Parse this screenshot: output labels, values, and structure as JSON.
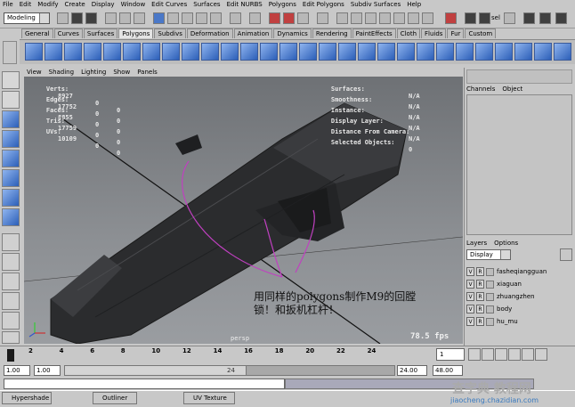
{
  "menubar": {
    "items": [
      "File",
      "Edit",
      "Modify",
      "Create",
      "Display",
      "Window",
      "Edit Curves",
      "Surfaces",
      "Edit NURBS",
      "Polygons",
      "Edit Polygons",
      "Subdiv Surfaces",
      "Help"
    ]
  },
  "statusline": {
    "mode": "Modeling",
    "sel_label": "sel"
  },
  "shelf": {
    "tabs": [
      "General",
      "Curves",
      "Surfaces",
      "Polygons",
      "Subdivs",
      "Deformation",
      "Animation",
      "Dynamics",
      "Rendering",
      "PaintEffects",
      "Cloth",
      "Fluids",
      "Fur",
      "Custom"
    ],
    "active_tab": "Polygons"
  },
  "panel_menu": [
    "View",
    "Shading",
    "Lighting",
    "Show",
    "Panels"
  ],
  "hud": {
    "rows": [
      {
        "label": "Verts:",
        "values": [
          "8927",
          "0",
          "0"
        ]
      },
      {
        "label": "Edges:",
        "values": [
          "17752",
          "0",
          "0"
        ]
      },
      {
        "label": "Faces:",
        "values": [
          "8855",
          "0",
          "0"
        ]
      },
      {
        "label": "Tris:",
        "values": [
          "17759",
          "0",
          "0"
        ]
      },
      {
        "label": "UVs:",
        "values": [
          "10109",
          "0",
          "0"
        ]
      }
    ],
    "right_rows": [
      {
        "label": "Surfaces:",
        "value": "N/A"
      },
      {
        "label": "Smoothness:",
        "value": "N/A"
      },
      {
        "label": "Instance:",
        "value": "N/A"
      },
      {
        "label": "Display Layer:",
        "value": "N/A"
      },
      {
        "label": "Distance From Camera:",
        "value": "N/A"
      },
      {
        "label": "Selected Objects:",
        "value": "0"
      }
    ],
    "fps": "78.5 fps",
    "camera": "persp"
  },
  "annotation": {
    "line1": "用同样的polygons制作M9的回膛",
    "line2": "锁！和扳机杠杆！"
  },
  "channel_box": {
    "menu": [
      "Channels",
      "Object"
    ]
  },
  "layers": {
    "menu": [
      "Layers",
      "Options"
    ],
    "display": "Display",
    "items": [
      {
        "v": "V",
        "r": "R",
        "name": "fasheqiangguan"
      },
      {
        "v": "V",
        "r": "R",
        "name": "xiaguan"
      },
      {
        "v": "V",
        "r": "R",
        "name": "zhuangzhen"
      },
      {
        "v": "V",
        "r": "R",
        "name": "body"
      },
      {
        "v": "V",
        "r": "R",
        "name": "hu_mu"
      }
    ]
  },
  "timeline": {
    "ticks": [
      "2",
      "4",
      "6",
      "8",
      "10",
      "12",
      "14",
      "16",
      "18",
      "20",
      "22",
      "24"
    ],
    "current_frame": "1"
  },
  "range": {
    "start": "1.00",
    "playback_start": "1.00",
    "mid_label": "24",
    "playback_end": "24.00",
    "end": "48.00"
  },
  "taskbar": {
    "items": [
      "Hypershade",
      "Outliner",
      "UV Texture ..."
    ]
  },
  "watermark": {
    "text": "查字典 教程网",
    "url": "jiaocheng.chazidian.com"
  }
}
